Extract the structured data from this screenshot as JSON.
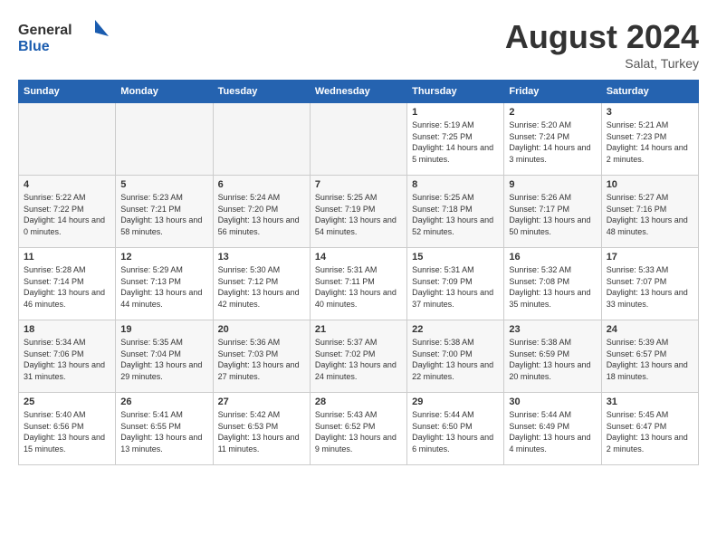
{
  "header": {
    "logo_general": "General",
    "logo_blue": "Blue",
    "month_year": "August 2024",
    "location": "Salat, Turkey"
  },
  "days_of_week": [
    "Sunday",
    "Monday",
    "Tuesday",
    "Wednesday",
    "Thursday",
    "Friday",
    "Saturday"
  ],
  "weeks": [
    [
      {
        "day": "",
        "empty": true
      },
      {
        "day": "",
        "empty": true
      },
      {
        "day": "",
        "empty": true
      },
      {
        "day": "",
        "empty": true
      },
      {
        "day": "1",
        "sunrise": "5:19 AM",
        "sunset": "7:25 PM",
        "daylight": "14 hours and 5 minutes."
      },
      {
        "day": "2",
        "sunrise": "5:20 AM",
        "sunset": "7:24 PM",
        "daylight": "14 hours and 3 minutes."
      },
      {
        "day": "3",
        "sunrise": "5:21 AM",
        "sunset": "7:23 PM",
        "daylight": "14 hours and 2 minutes."
      }
    ],
    [
      {
        "day": "4",
        "sunrise": "5:22 AM",
        "sunset": "7:22 PM",
        "daylight": "14 hours and 0 minutes."
      },
      {
        "day": "5",
        "sunrise": "5:23 AM",
        "sunset": "7:21 PM",
        "daylight": "13 hours and 58 minutes."
      },
      {
        "day": "6",
        "sunrise": "5:24 AM",
        "sunset": "7:20 PM",
        "daylight": "13 hours and 56 minutes."
      },
      {
        "day": "7",
        "sunrise": "5:25 AM",
        "sunset": "7:19 PM",
        "daylight": "13 hours and 54 minutes."
      },
      {
        "day": "8",
        "sunrise": "5:25 AM",
        "sunset": "7:18 PM",
        "daylight": "13 hours and 52 minutes."
      },
      {
        "day": "9",
        "sunrise": "5:26 AM",
        "sunset": "7:17 PM",
        "daylight": "13 hours and 50 minutes."
      },
      {
        "day": "10",
        "sunrise": "5:27 AM",
        "sunset": "7:16 PM",
        "daylight": "13 hours and 48 minutes."
      }
    ],
    [
      {
        "day": "11",
        "sunrise": "5:28 AM",
        "sunset": "7:14 PM",
        "daylight": "13 hours and 46 minutes."
      },
      {
        "day": "12",
        "sunrise": "5:29 AM",
        "sunset": "7:13 PM",
        "daylight": "13 hours and 44 minutes."
      },
      {
        "day": "13",
        "sunrise": "5:30 AM",
        "sunset": "7:12 PM",
        "daylight": "13 hours and 42 minutes."
      },
      {
        "day": "14",
        "sunrise": "5:31 AM",
        "sunset": "7:11 PM",
        "daylight": "13 hours and 40 minutes."
      },
      {
        "day": "15",
        "sunrise": "5:31 AM",
        "sunset": "7:09 PM",
        "daylight": "13 hours and 37 minutes."
      },
      {
        "day": "16",
        "sunrise": "5:32 AM",
        "sunset": "7:08 PM",
        "daylight": "13 hours and 35 minutes."
      },
      {
        "day": "17",
        "sunrise": "5:33 AM",
        "sunset": "7:07 PM",
        "daylight": "13 hours and 33 minutes."
      }
    ],
    [
      {
        "day": "18",
        "sunrise": "5:34 AM",
        "sunset": "7:06 PM",
        "daylight": "13 hours and 31 minutes."
      },
      {
        "day": "19",
        "sunrise": "5:35 AM",
        "sunset": "7:04 PM",
        "daylight": "13 hours and 29 minutes."
      },
      {
        "day": "20",
        "sunrise": "5:36 AM",
        "sunset": "7:03 PM",
        "daylight": "13 hours and 27 minutes."
      },
      {
        "day": "21",
        "sunrise": "5:37 AM",
        "sunset": "7:02 PM",
        "daylight": "13 hours and 24 minutes."
      },
      {
        "day": "22",
        "sunrise": "5:38 AM",
        "sunset": "7:00 PM",
        "daylight": "13 hours and 22 minutes."
      },
      {
        "day": "23",
        "sunrise": "5:38 AM",
        "sunset": "6:59 PM",
        "daylight": "13 hours and 20 minutes."
      },
      {
        "day": "24",
        "sunrise": "5:39 AM",
        "sunset": "6:57 PM",
        "daylight": "13 hours and 18 minutes."
      }
    ],
    [
      {
        "day": "25",
        "sunrise": "5:40 AM",
        "sunset": "6:56 PM",
        "daylight": "13 hours and 15 minutes."
      },
      {
        "day": "26",
        "sunrise": "5:41 AM",
        "sunset": "6:55 PM",
        "daylight": "13 hours and 13 minutes."
      },
      {
        "day": "27",
        "sunrise": "5:42 AM",
        "sunset": "6:53 PM",
        "daylight": "13 hours and 11 minutes."
      },
      {
        "day": "28",
        "sunrise": "5:43 AM",
        "sunset": "6:52 PM",
        "daylight": "13 hours and 9 minutes."
      },
      {
        "day": "29",
        "sunrise": "5:44 AM",
        "sunset": "6:50 PM",
        "daylight": "13 hours and 6 minutes."
      },
      {
        "day": "30",
        "sunrise": "5:44 AM",
        "sunset": "6:49 PM",
        "daylight": "13 hours and 4 minutes."
      },
      {
        "day": "31",
        "sunrise": "5:45 AM",
        "sunset": "6:47 PM",
        "daylight": "13 hours and 2 minutes."
      }
    ]
  ]
}
